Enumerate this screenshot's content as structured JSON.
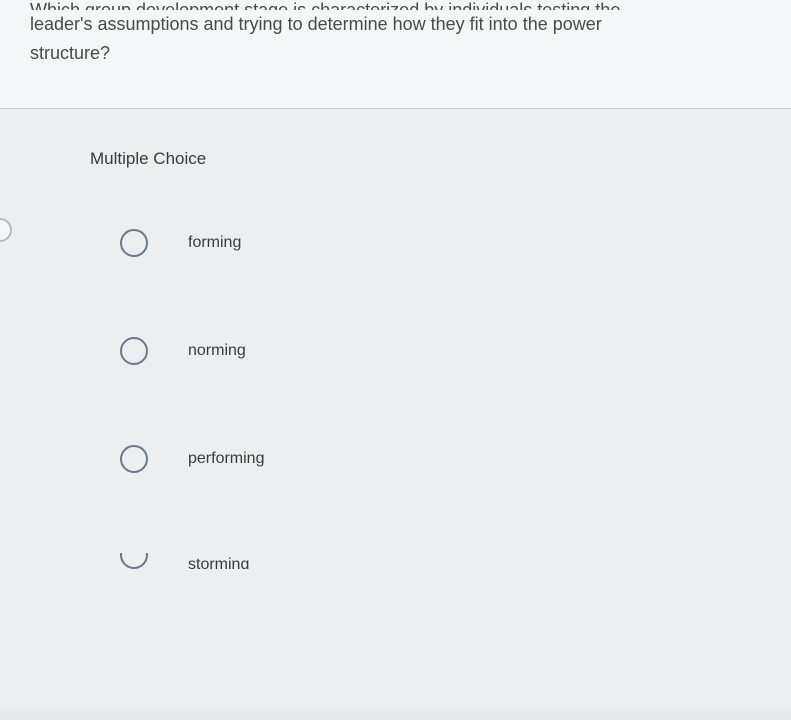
{
  "question": {
    "line1_cut": "Which group development stage is characterized by individuals testing the",
    "line2": "leader's assumptions and trying to determine how they fit into the power",
    "line3": "structure?"
  },
  "section_label": "Multiple Choice",
  "options": [
    {
      "label": "forming"
    },
    {
      "label": "norming"
    },
    {
      "label": "performing"
    },
    {
      "label": "storming"
    }
  ]
}
